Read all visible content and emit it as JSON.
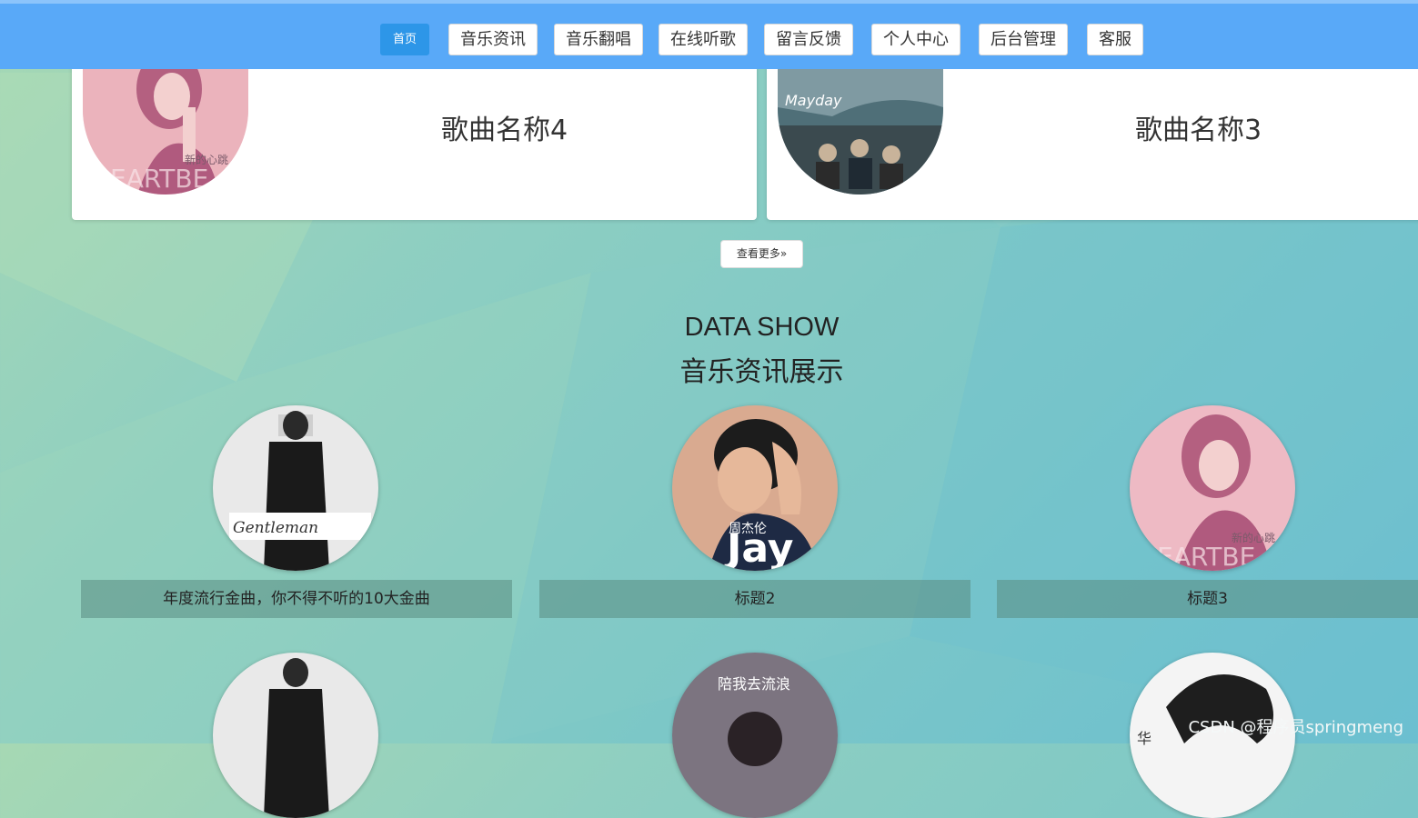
{
  "nav": {
    "items": [
      {
        "label": "首页",
        "active": true
      },
      {
        "label": "音乐资讯"
      },
      {
        "label": "音乐翻唱"
      },
      {
        "label": "在线听歌"
      },
      {
        "label": "留言反馈"
      },
      {
        "label": "个人中心"
      },
      {
        "label": "后台管理"
      },
      {
        "label": "客服"
      }
    ],
    "bar_color": "#59a9f8",
    "active_color": "#2d96e8"
  },
  "songs": {
    "cards": [
      {
        "title": "歌曲名称4",
        "cover_text": "新的心跳",
        "cover_letters": "EARTBE"
      },
      {
        "title": "歌曲名称3",
        "cover_text": "Mayday"
      }
    ],
    "more_label": "查看更多»"
  },
  "news": {
    "title_en": "DATA SHOW",
    "title_cn": "音乐资讯展示",
    "items": [
      {
        "caption": "年度流行金曲，你不得不听的10大金曲",
        "cover_text": "Gentleman"
      },
      {
        "caption": "标题2",
        "cover_text": "Jay",
        "cover_sub": "周杰伦"
      },
      {
        "caption": "标题3",
        "cover_text": "新的心跳",
        "cover_letters": "EARTBE"
      }
    ],
    "row2": [
      {
        "cover_text": ""
      },
      {
        "cover_text": "陪我去流浪"
      },
      {
        "cover_text": "华"
      }
    ]
  },
  "watermark": "CSDN @程序员springmeng"
}
